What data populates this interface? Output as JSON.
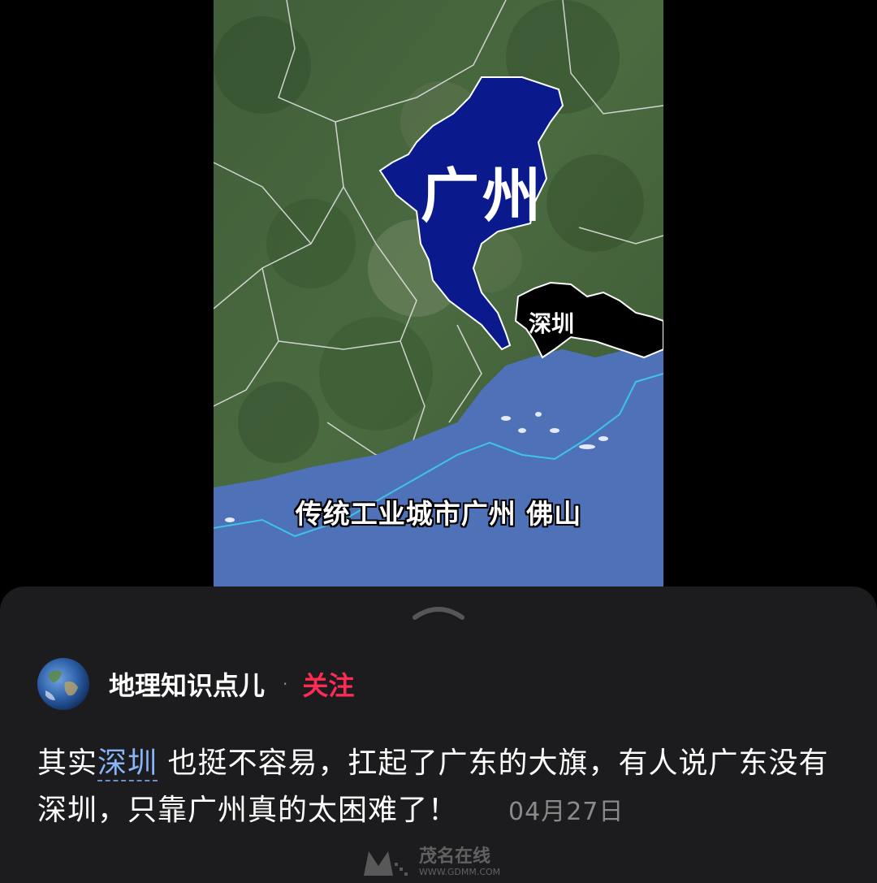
{
  "video": {
    "map_label_large": "广州",
    "map_label_small": "深圳",
    "subtitle": "传统工业城市广州 佛山",
    "colors": {
      "guangzhou": "#0a1a8c",
      "shenzhen": "#000000",
      "sea": "#4f71b8"
    }
  },
  "sheet": {
    "handle_icon": "chevron-up-icon"
  },
  "author": {
    "name": "地理知识点儿",
    "separator": "·",
    "follow_label": "关注",
    "follow_color": "#fe2c55"
  },
  "caption": {
    "before_tag": "其实",
    "tag": "深圳",
    "after_tag": " 也挺不容易，扛起了广东的大旗，有人说广东没有深圳，只靠广州真的太困难了！",
    "date": "04月27日"
  },
  "watermark": {
    "brand": "茂名在线",
    "url": "WWW.GDMM.COM"
  }
}
